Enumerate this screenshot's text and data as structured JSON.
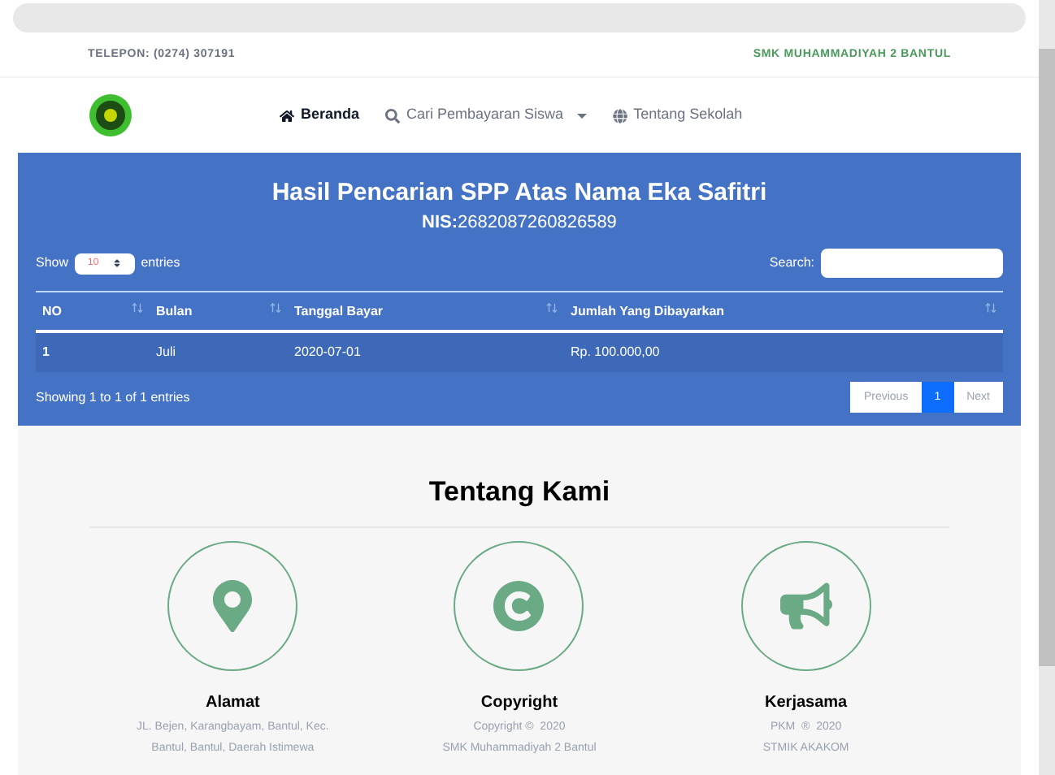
{
  "topbar": {
    "phone": "TELEPON: (0274) 307191",
    "school": "SMK MUHAMMADIYAH 2 BANTUL"
  },
  "nav": [
    {
      "label": "Beranda",
      "selected": true,
      "dropdown": false
    },
    {
      "label": "Cari Pembayaran Siswa",
      "selected": false,
      "dropdown": true
    },
    {
      "label": "Tentang Sekolah",
      "selected": false,
      "dropdown": false
    }
  ],
  "result": {
    "title": "Hasil Pencarian SPP Atas Nama Eka Safitri",
    "nis_label": "NIS:",
    "nis": "2682087260826589",
    "show": "Show",
    "page_size": "10",
    "entries": "entries",
    "search_label": "Search:",
    "columns": [
      "NO",
      "Bulan",
      "Tanggal Bayar",
      "Jumlah Yang Dibayarkan"
    ],
    "rows": [
      [
        "1",
        "Juli",
        "2020-07-01",
        "Rp. 100.000,00"
      ]
    ],
    "info": "Showing 1 to 1 of 1 entries",
    "pagination": [
      {
        "label": "Previous",
        "selected": false
      },
      {
        "label": "1",
        "selected": true
      },
      {
        "label": "Next",
        "selected": false
      }
    ]
  },
  "about": {
    "title": "Tentang Kami",
    "cards": [
      {
        "title": "Alamat",
        "lines": [
          "JL. Bejen, Karangbayam, Bantul, Kec.",
          "Bantul, Bantul, Daerah Istimewa"
        ]
      },
      {
        "title": "Copyright",
        "lines": [
          "Copyright ©  2020",
          "SMK Muhammadiyah 2 Bantul"
        ]
      },
      {
        "title": "Kerjasama",
        "lines": [
          "PKM  ®  2020",
          "STMIK AKAKOM"
        ]
      }
    ]
  }
}
